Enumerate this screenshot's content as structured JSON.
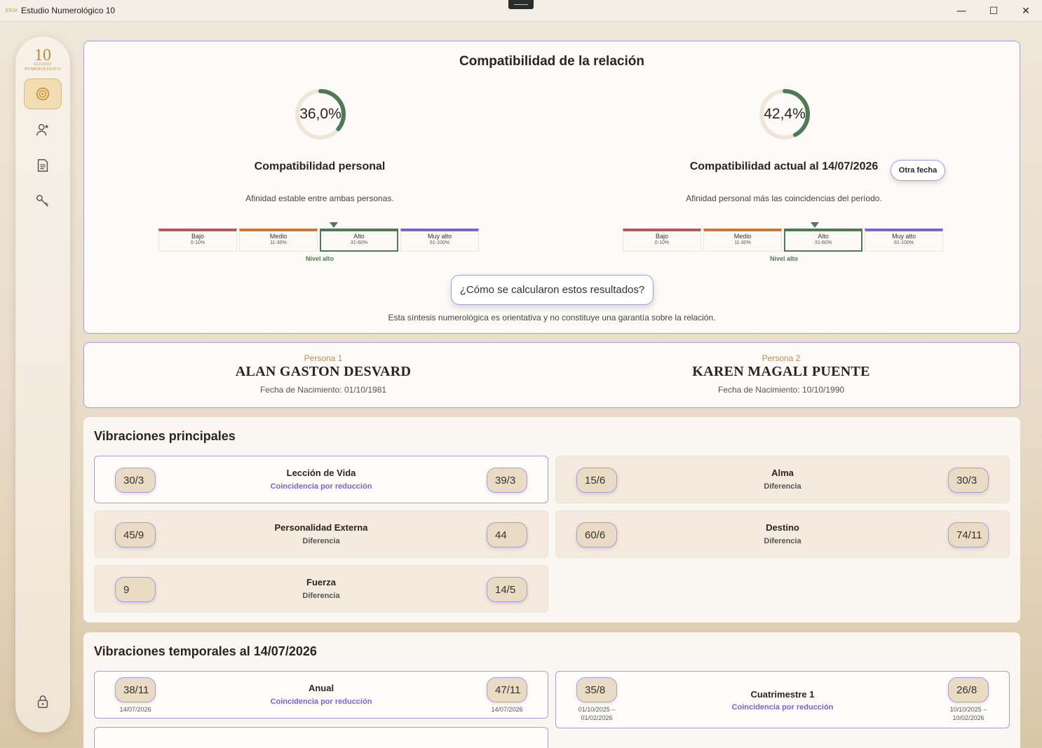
{
  "window": {
    "title": "Estudio Numerológico 10",
    "app_icon_text": "EN10",
    "minimize": "—",
    "maximize": "☐",
    "close": "✕"
  },
  "sidebar": {
    "logo": {
      "number": "10",
      "line1": "ESTUDIO",
      "line2": "NUMEROLÓGICO"
    },
    "items": [
      {
        "name": "compatibility",
        "icon": "coin-icon",
        "active": true
      },
      {
        "name": "persons",
        "icon": "person-icon",
        "active": false
      },
      {
        "name": "report",
        "icon": "document-icon",
        "active": false
      },
      {
        "name": "license",
        "icon": "key-icon",
        "active": false
      },
      {
        "name": "lock",
        "icon": "lock-icon",
        "active": false
      }
    ]
  },
  "compat": {
    "title": "Compatibilidad de la relación",
    "personal": {
      "value_text": "36,0%",
      "percent": 36.0,
      "title": "Compatibilidad personal",
      "desc": "Afinidad estable entre ambas personas.",
      "level": "Nivel alto"
    },
    "current": {
      "value_text": "42,4%",
      "percent": 42.4,
      "title": "Compatibilidad actual al 14/07/2026",
      "desc": "Afinidad personal más las coincidencias del período.",
      "level": "Nivel alto",
      "other_date_label": "Otra fecha"
    },
    "scale": [
      {
        "label": "Bajo",
        "range": "0-10%",
        "color": "#b05a5a"
      },
      {
        "label": "Medio",
        "range": "11-30%",
        "color": "#c8793a"
      },
      {
        "label": "Alto",
        "range": "31-60%",
        "color": "#4f7a55"
      },
      {
        "label": "Muy alto",
        "range": "61-100%",
        "color": "#7d64c8"
      }
    ],
    "how_label": "¿Cómo se calcularon estos resultados?",
    "disclaimer": "Esta síntesis numerológica es orientativa y no constituye una garantía sobre la relación."
  },
  "persons": {
    "p1": {
      "label": "Persona 1",
      "name": "ALAN GASTON DESVARD",
      "birth": "Fecha de Nacimiento: 01/10/1981"
    },
    "p2": {
      "label": "Persona 2",
      "name": "KAREN MAGALI PUENTE",
      "birth": "Fecha de Nacimiento: 10/10/1990"
    }
  },
  "vibrations": {
    "title": "Vibraciones principales",
    "items": [
      {
        "name": "Lección de Vida",
        "status": "Coincidencia por reducción",
        "left": "30/3",
        "right": "39/3"
      },
      {
        "name": "Alma",
        "status": "Diferencia",
        "left": "15/6",
        "right": "30/3"
      },
      {
        "name": "Personalidad Externa",
        "status": "Diferencia",
        "left": "45/9",
        "right": "44"
      },
      {
        "name": "Destino",
        "status": "Diferencia",
        "left": "60/6",
        "right": "74/11"
      },
      {
        "name": "Fuerza",
        "status": "Diferencia",
        "left": "9",
        "right": "14/5"
      }
    ]
  },
  "temporal": {
    "title": "Vibraciones temporales al 14/07/2026",
    "items": [
      {
        "name": "Anual",
        "status": "Coincidencia por reducción",
        "left": "38/11",
        "right": "47/11",
        "left_date": "14/07/2026",
        "right_date": "14/07/2026"
      },
      {
        "name": "Cuatrimestre 1",
        "status": "Coincidencia por reducción",
        "left": "35/8",
        "right": "26/8",
        "left_date_1": "01/10/2025 –",
        "left_date_2": "01/02/2026",
        "right_date_1": "10/10/2025 –",
        "right_date_2": "10/02/2026"
      }
    ]
  }
}
